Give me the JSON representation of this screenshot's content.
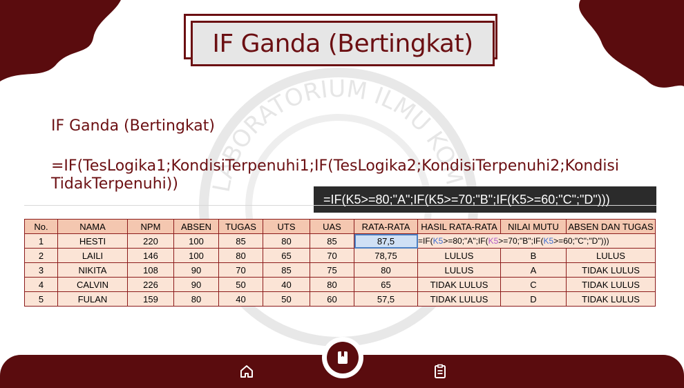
{
  "title": "IF Ganda (Bertingkat)",
  "heading": "IF Ganda (Bertingkat)",
  "formula_syntax": "=IF(TesLogika1;KondisiTerpenuhi1;IF(TesLogika2;KondisiTerpenuhi2;Kondisi TidakTerpenuhi))",
  "formula_bar": "=IF(K5>=80;\"A\";IF(K5>=70;\"B\";IF(K5>=60;\"C\";\"D\")))",
  "watermark_text": "LABORATORIUM ILMU KOMPUTER",
  "table": {
    "headers": [
      "No.",
      "NAMA",
      "NPM",
      "ABSEN",
      "TUGAS",
      "UTS",
      "UAS",
      "RATA-RATA",
      "HASIL RATA-RATA",
      "NILAI MUTU",
      "ABSEN DAN TUGAS"
    ],
    "rows": [
      [
        "1",
        "HESTI",
        "220",
        "100",
        "85",
        "80",
        "85",
        "87,5",
        "",
        "",
        ""
      ],
      [
        "2",
        "LAILI",
        "146",
        "100",
        "80",
        "65",
        "70",
        "78,75",
        "LULUS",
        "B",
        "LULUS"
      ],
      [
        "3",
        "NIKITA",
        "108",
        "90",
        "70",
        "85",
        "75",
        "80",
        "LULUS",
        "A",
        "TIDAK LULUS"
      ],
      [
        "4",
        "CALVIN",
        "226",
        "90",
        "50",
        "40",
        "80",
        "65",
        "TIDAK LULUS",
        "C",
        "TIDAK LULUS"
      ],
      [
        "5",
        "FULAN",
        "159",
        "80",
        "40",
        "50",
        "60",
        "57,5",
        "TIDAK LULUS",
        "D",
        "TIDAK LULUS"
      ]
    ],
    "editing_cell": {
      "p1": "=IF(",
      "r1": "K5",
      "p2": ">=80;\"A\";IF(",
      "r2": "K5",
      "p3": ">=70;\"B\";IF(",
      "r3": "K5",
      "p4": ">=60;\"C\";\"D\")))"
    }
  },
  "nav": {
    "home_icon": "home-icon",
    "book_icon": "book-icon",
    "clipboard_icon": "clipboard-icon"
  },
  "colors": {
    "brand": "#6b0f12",
    "header_fill": "#f4c7b0",
    "cell_fill": "#fbe4d6"
  }
}
